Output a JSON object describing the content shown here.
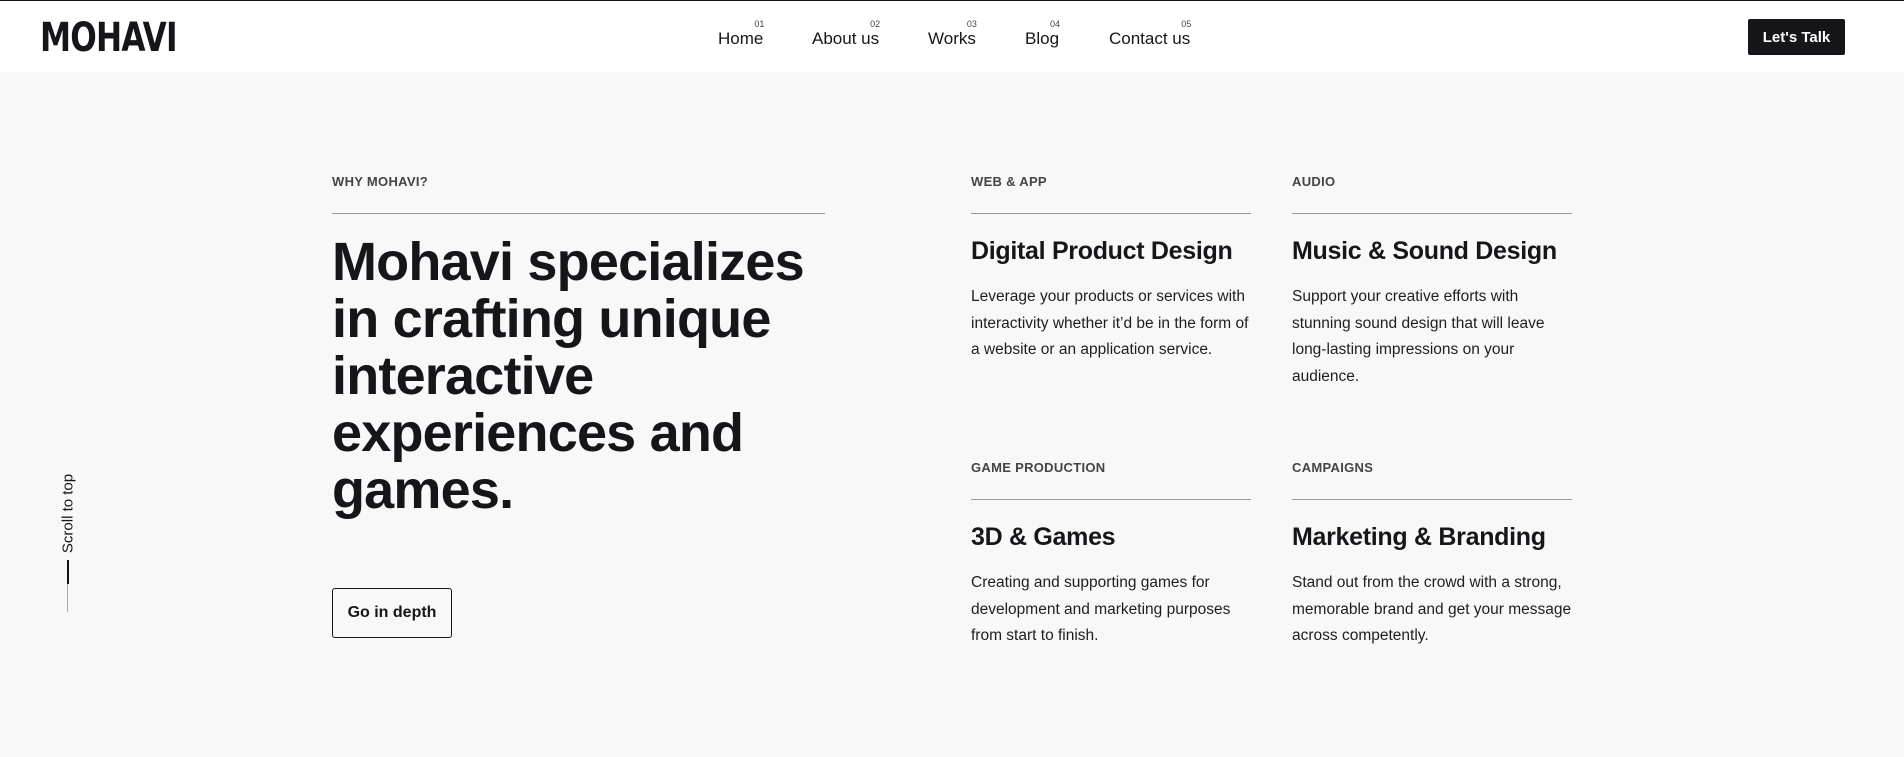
{
  "header": {
    "logo": "MOHAVI",
    "nav": [
      {
        "label": "Home",
        "num": "01"
      },
      {
        "label": "About us",
        "num": "02"
      },
      {
        "label": "Works",
        "num": "03"
      },
      {
        "label": "Blog",
        "num": "04"
      },
      {
        "label": "Contact us",
        "num": "05"
      }
    ],
    "cta": "Let's Talk"
  },
  "scroll": {
    "label": "Scroll to top"
  },
  "why": {
    "kicker": "WHY MOHAVI?",
    "headline": "Mohavi specializes in crafting unique interactive experiences and games.",
    "button": "Go in depth"
  },
  "services": [
    {
      "kicker": "WEB & APP",
      "title": "Digital Product Design",
      "desc": "Leverage your products or services with interactivity whether it’d be in the form of a website or an application service."
    },
    {
      "kicker": "AUDIO",
      "title": "Music & Sound Design",
      "desc": "Support your creative efforts with stunning sound design that will leave long-lasting impressions on your audience."
    },
    {
      "kicker": "GAME PRODUCTION",
      "title": "3D & Games",
      "desc": "Creating and supporting games for development and marketing purposes from start to finish."
    },
    {
      "kicker": "CAMPAIGNS",
      "title": "Marketing & Branding",
      "desc": "Stand out from the crowd with a strong, memorable brand and get your message across competently."
    }
  ]
}
